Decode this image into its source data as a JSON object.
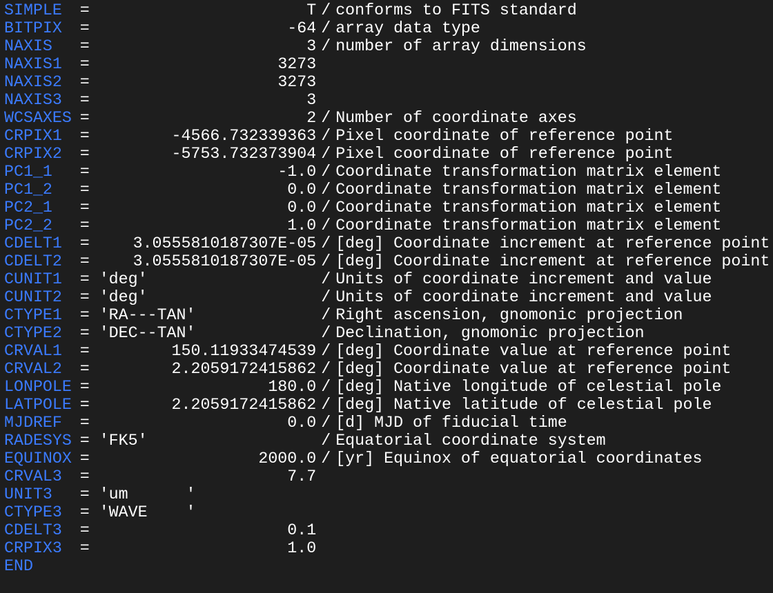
{
  "terminal": {
    "cards": [
      {
        "keyword": "SIMPLE",
        "value": "T",
        "value_type": "num",
        "comment": "conforms to FITS standard"
      },
      {
        "keyword": "BITPIX",
        "value": "-64",
        "value_type": "num",
        "comment": "array data type"
      },
      {
        "keyword": "NAXIS",
        "value": "3",
        "value_type": "num",
        "comment": "number of array dimensions"
      },
      {
        "keyword": "NAXIS1",
        "value": "3273",
        "value_type": "num",
        "comment": ""
      },
      {
        "keyword": "NAXIS2",
        "value": "3273",
        "value_type": "num",
        "comment": ""
      },
      {
        "keyword": "NAXIS3",
        "value": "3",
        "value_type": "num",
        "comment": ""
      },
      {
        "keyword": "WCSAXES",
        "value": "2",
        "value_type": "num",
        "comment": "Number of coordinate axes"
      },
      {
        "keyword": "CRPIX1",
        "value": "-4566.732339363",
        "value_type": "num",
        "comment": "Pixel coordinate of reference point"
      },
      {
        "keyword": "CRPIX2",
        "value": "-5753.732373904",
        "value_type": "num",
        "comment": "Pixel coordinate of reference point"
      },
      {
        "keyword": "PC1_1",
        "value": "-1.0",
        "value_type": "num",
        "comment": "Coordinate transformation matrix element"
      },
      {
        "keyword": "PC1_2",
        "value": "0.0",
        "value_type": "num",
        "comment": "Coordinate transformation matrix element"
      },
      {
        "keyword": "PC2_1",
        "value": "0.0",
        "value_type": "num",
        "comment": "Coordinate transformation matrix element"
      },
      {
        "keyword": "PC2_2",
        "value": "1.0",
        "value_type": "num",
        "comment": "Coordinate transformation matrix element"
      },
      {
        "keyword": "CDELT1",
        "value": "3.0555810187307E-05",
        "value_type": "num",
        "comment": "[deg] Coordinate increment at reference point"
      },
      {
        "keyword": "CDELT2",
        "value": "3.0555810187307E-05",
        "value_type": "num",
        "comment": "[deg] Coordinate increment at reference point"
      },
      {
        "keyword": "CUNIT1",
        "value": "'deg'",
        "value_type": "str",
        "comment": "Units of coordinate increment and value"
      },
      {
        "keyword": "CUNIT2",
        "value": "'deg'",
        "value_type": "str",
        "comment": "Units of coordinate increment and value"
      },
      {
        "keyword": "CTYPE1",
        "value": "'RA---TAN'",
        "value_type": "str",
        "comment": "Right ascension, gnomonic projection"
      },
      {
        "keyword": "CTYPE2",
        "value": "'DEC--TAN'",
        "value_type": "str",
        "comment": "Declination, gnomonic projection"
      },
      {
        "keyword": "CRVAL1",
        "value": "150.11933474539",
        "value_type": "num",
        "comment": "[deg] Coordinate value at reference point"
      },
      {
        "keyword": "CRVAL2",
        "value": "2.2059172415862",
        "value_type": "num",
        "comment": "[deg] Coordinate value at reference point"
      },
      {
        "keyword": "LONPOLE",
        "value": "180.0",
        "value_type": "num",
        "comment": "[deg] Native longitude of celestial pole"
      },
      {
        "keyword": "LATPOLE",
        "value": "2.2059172415862",
        "value_type": "num",
        "comment": "[deg] Native latitude of celestial pole"
      },
      {
        "keyword": "MJDREF",
        "value": "0.0",
        "value_type": "num",
        "comment": "[d] MJD of fiducial time"
      },
      {
        "keyword": "RADESYS",
        "value": "'FK5'",
        "value_type": "str",
        "comment": "Equatorial coordinate system"
      },
      {
        "keyword": "EQUINOX",
        "value": "2000.0",
        "value_type": "num",
        "comment": "[yr] Equinox of equatorial coordinates"
      },
      {
        "keyword": "CRVAL3",
        "value": "7.7",
        "value_type": "num",
        "comment": ""
      },
      {
        "keyword": "UNIT3",
        "value": "'um      '",
        "value_type": "str",
        "comment": ""
      },
      {
        "keyword": "CTYPE3",
        "value": "'WAVE    '",
        "value_type": "str",
        "comment": ""
      },
      {
        "keyword": "CDELT3",
        "value": "0.1",
        "value_type": "num",
        "comment": ""
      },
      {
        "keyword": "CRPIX3",
        "value": "1.0",
        "value_type": "num",
        "comment": ""
      }
    ],
    "end_keyword": "END",
    "equals_sign": "=",
    "comment_separator": "/"
  }
}
